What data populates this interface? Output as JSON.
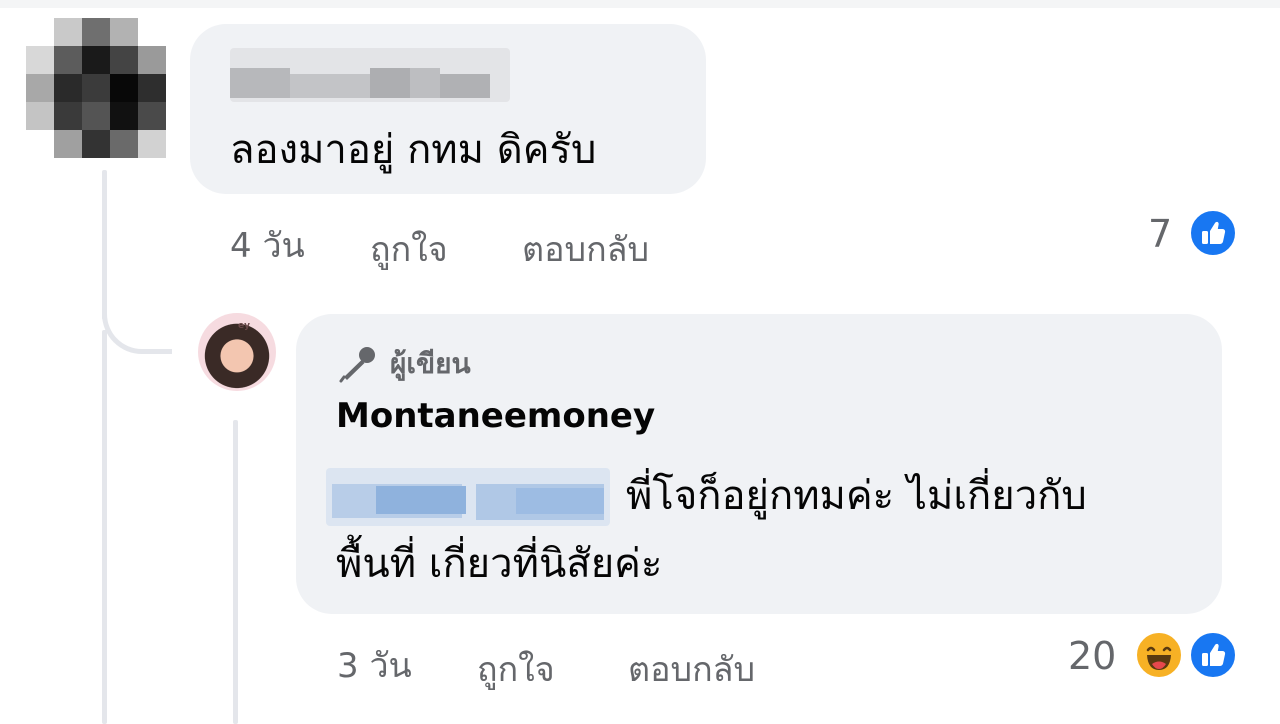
{
  "comment1": {
    "text": "ลองมาอยู่ กทม ดิครับ",
    "time": "4 วัน",
    "like_label": "ถูกใจ",
    "reply_label": "ตอบกลับ",
    "reaction_count": "7",
    "reactions": [
      "like-icon"
    ]
  },
  "comment2": {
    "badge_label": "ผู้เขียน",
    "badge_icon": "microphone-icon",
    "author": "Montaneemoney",
    "text_line1": "พี่โจก็อยู่กทมค่ะ ไม่เกี่ยวกับ",
    "text_line2": "พื้นที่ เกี่ยวที่นิสัยค่ะ",
    "time": "3 วัน",
    "like_label": "ถูกใจ",
    "reply_label": "ตอบกลับ",
    "reaction_count": "20",
    "reactions": [
      "haha-icon",
      "like-icon"
    ]
  },
  "colors": {
    "bubble": "#f0f2f5",
    "meta_text": "#65676b",
    "like_blue": "#1877f2",
    "haha_yellow": "#f7b125"
  }
}
